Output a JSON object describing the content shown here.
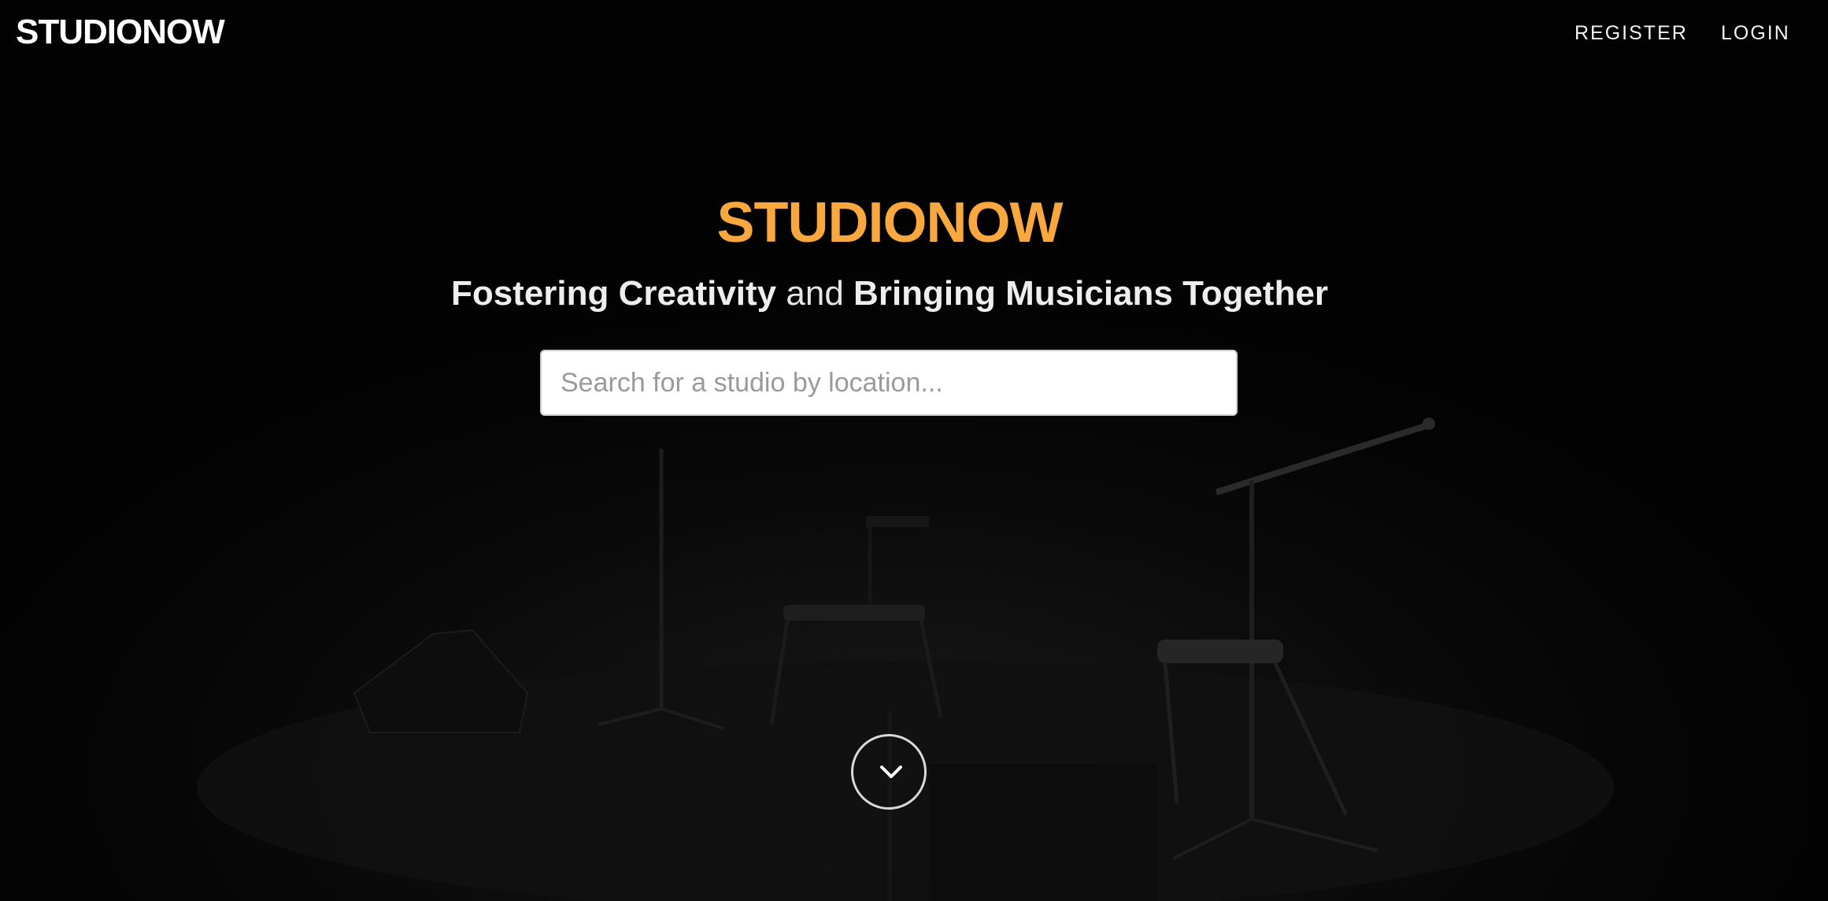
{
  "nav": {
    "brand": "STUDIONOW",
    "register_label": "REGISTER",
    "login_label": "LOGIN"
  },
  "hero": {
    "title": "STUDIONOW",
    "subtitle_part1": "Fostering Creativity",
    "subtitle_connector": "and",
    "subtitle_part2": "Bringing Musicians Together",
    "search_placeholder": "Search for a studio by location..."
  },
  "icons": {
    "scroll": "chevron-down-icon"
  },
  "colors": {
    "accent": "#f9a83f",
    "background": "#050505",
    "text": "#ffffff"
  }
}
